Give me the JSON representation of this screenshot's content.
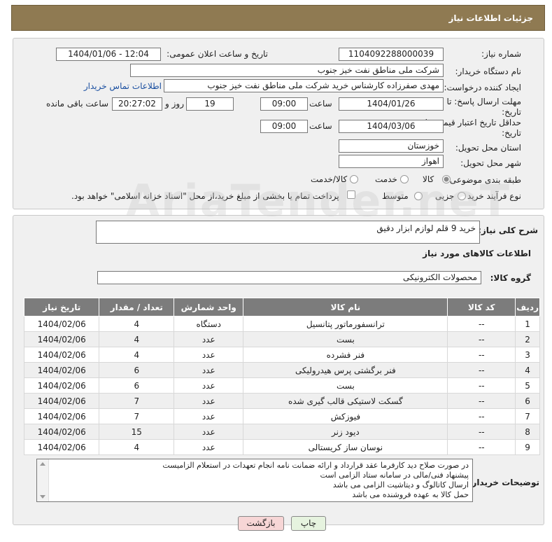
{
  "header": {
    "title": "جزئیات اطلاعات نیاز"
  },
  "form": {
    "need_number": {
      "label": "شماره نیاز:",
      "value": "1104092288000039"
    },
    "announce": {
      "label": "تاریخ و ساعت اعلان عمومی:",
      "value": "1404/01/06 - 12:04"
    },
    "buyer_org": {
      "label": "نام دستگاه خریدار:",
      "value": "شرکت ملی مناطق نفت خیز جنوب"
    },
    "requester": {
      "label": "ایجاد کننده درخواست:",
      "value": "مهدی صفرزاده کارشناس خرید شرکت ملی مناطق نفت خیز جنوب",
      "contact_link": "اطلاعات تماس خریدار"
    },
    "reply_deadline": {
      "label": "مهلت ارسال پاسخ: تا تاریخ:",
      "date": "1404/01/26",
      "time_label": "ساعت",
      "time": "09:00",
      "days": "19",
      "days_label": "روز و",
      "remaining": "20:27:02",
      "remaining_label": "ساعت باقی مانده"
    },
    "price_validity": {
      "label": "حداقل تاریخ اعتبار قیمت: تا تاریخ:",
      "date": "1404/03/06",
      "time_label": "ساعت",
      "time": "09:00"
    },
    "province": {
      "label": "استان محل تحویل:",
      "value": "خوزستان"
    },
    "city": {
      "label": "شهر محل تحویل:",
      "value": "اهواز"
    },
    "category": {
      "label": "طبقه بندی موضوعی:",
      "options": [
        "کالا",
        "خدمت",
        "کالا/خدمت"
      ],
      "selected": "کالا"
    },
    "purchase_type": {
      "label": "نوع فرآیند خرید :",
      "options": [
        "جزیی",
        "متوسط"
      ],
      "note": "پرداخت تمام یا بخشی از مبلغ خرید،از محل \"اسناد خزانه اسلامی\" خواهد بود."
    }
  },
  "summary": {
    "label": "شرح کلی نیاز:",
    "value": "خرید 9 قلم لوازم ابزار دقیق",
    "items_title": "اطلاعات کالاهای مورد نیاز",
    "group_label": "گروه کالا:",
    "group_value": "محصولات الکترونیکی"
  },
  "table": {
    "headers": [
      "ردیف",
      "کد کالا",
      "نام کالا",
      "واحد شمارش",
      "تعداد / مقدار",
      "تاریخ نیاز"
    ],
    "rows": [
      [
        "1",
        "--",
        "ترانسفورماتور پتانسیل",
        "دستگاه",
        "4",
        "1404/02/06"
      ],
      [
        "2",
        "--",
        "بست",
        "عدد",
        "4",
        "1404/02/06"
      ],
      [
        "3",
        "--",
        "فنر فشرده",
        "عدد",
        "4",
        "1404/02/06"
      ],
      [
        "4",
        "--",
        "فنر برگشتی پرس هیدرولیکی",
        "عدد",
        "6",
        "1404/02/06"
      ],
      [
        "5",
        "--",
        "بست",
        "عدد",
        "6",
        "1404/02/06"
      ],
      [
        "6",
        "--",
        "گسکت لاستیکی قالب گیری شده",
        "عدد",
        "7",
        "1404/02/06"
      ],
      [
        "7",
        "--",
        "فیوزکش",
        "عدد",
        "7",
        "1404/02/06"
      ],
      [
        "8",
        "--",
        "دیود زنر",
        "عدد",
        "15",
        "1404/02/06"
      ],
      [
        "9",
        "--",
        "نوسان ساز کریستالی",
        "عدد",
        "4",
        "1404/02/06"
      ]
    ]
  },
  "buyer_notes": {
    "label": "توضیحات خریدار:",
    "lines": [
      "در صورت صلاح دید کارفرما عقد قرارداد و ارائه ضمانت نامه انجام تعهدات در استعلام الزامیست",
      "پیشنهاد فنی/مالی در سامانه ستاد الزامی است",
      "ارسال کاتالوگ و دیتاشیت الزامی می باشد",
      "حمل کالا به عهده فروشنده می باشد"
    ]
  },
  "buttons": {
    "print": "چاپ",
    "back": "بازگشت"
  },
  "watermark": "AriaTender.neT",
  "colors": {
    "header": "#8f7a52",
    "table_header": "#7c7c7c",
    "back_button": "#f7d6d6",
    "print_button": "#e6f3df"
  }
}
